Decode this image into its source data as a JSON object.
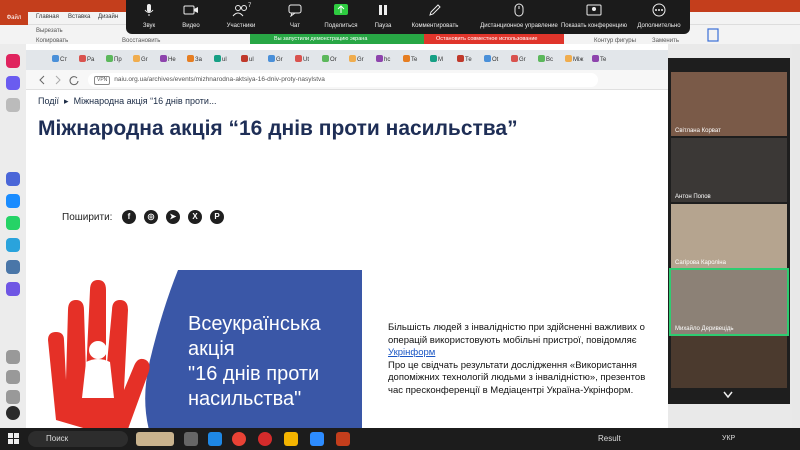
{
  "powerpoint": {
    "file_tab": "Файл",
    "tabs": [
      "Главная",
      "Вставка",
      "Дизайн"
    ],
    "clipboard": [
      "Вырезать",
      "Копировать"
    ],
    "restore_label": "Восстановить",
    "shape_outline": "Контур фигуры",
    "replace": "Заменить"
  },
  "zoom": {
    "buttons": [
      {
        "label": "Звук",
        "icon": "microphone-icon"
      },
      {
        "label": "Видео",
        "icon": "video-camera-icon"
      },
      {
        "label": "Участники",
        "icon": "participants-icon",
        "count": "7"
      },
      {
        "label": "Чат",
        "icon": "chat-icon"
      },
      {
        "label": "Поделиться",
        "icon": "share-screen-icon"
      },
      {
        "label": "Пауза",
        "icon": "pause-icon"
      },
      {
        "label": "Комментировать",
        "icon": "annotate-pen-icon"
      },
      {
        "label": "Дистанционное управление",
        "icon": "remote-control-mouse-icon"
      },
      {
        "label": "Показать конференцию",
        "icon": "show-meeting-icon"
      },
      {
        "label": "Дополнительно",
        "icon": "more-icon"
      }
    ],
    "share_banner": "Вы запустили демонстрацию экрана",
    "stop_share": "Остановить совместное использование",
    "participants": [
      {
        "name": "Світлана Корват"
      },
      {
        "name": "Антон Попов"
      },
      {
        "name": "Сагірова Кароліна"
      },
      {
        "name": "Михайло Деривецідь"
      }
    ]
  },
  "browser": {
    "url": "naiu.org.ua/archives/events/mizhnarodna-aktsiya-16-dniv-proty-nasylstva",
    "vpn_label": "VPN",
    "tabs": [
      "Ст",
      "Рa",
      "Пр",
      "Gr",
      "Не",
      "За",
      "ul",
      "ul",
      "Gr",
      "Ut",
      "Or",
      "Gr",
      "hc",
      "Te",
      "M",
      "Те",
      "Ot",
      "Gr",
      "Bc",
      "Між",
      "Te"
    ]
  },
  "page": {
    "breadcrumb_home": "Події",
    "breadcrumb_current": "Міжнародна акція “16 днів проти...",
    "title": "Міжнародна акція “16 днів проти насильства”",
    "share_label": "Поширити:",
    "banner_lines": [
      "Всеукраїнська",
      "акція",
      "\"16 днів проти",
      "насильства\""
    ],
    "article_p1": "Більшість людей з інвалідністю при здійсненні важливих о",
    "article_p1b": "операцій використовують мобільні пристрої, повідомляє",
    "article_link": "Укрінформ",
    "article_p2a": "Про це свідчать результати дослідження «Використання",
    "article_p2b": "допоміжних технологій людьми з інвалідністю», презентов",
    "article_p2c": "час пресконференції в Медіацентрі Україна-Укрінформ."
  },
  "taskbar": {
    "search": "Поиск",
    "result_label": "Result",
    "lang": "УКР"
  },
  "colors": {
    "zoom_bg": "#1b1b1b",
    "share_green": "#28a745",
    "stop_red": "#e0352b",
    "banner_blue": "#3a57a7",
    "title_navy": "#1e2e56",
    "ppt_red": "#c43e1c"
  }
}
